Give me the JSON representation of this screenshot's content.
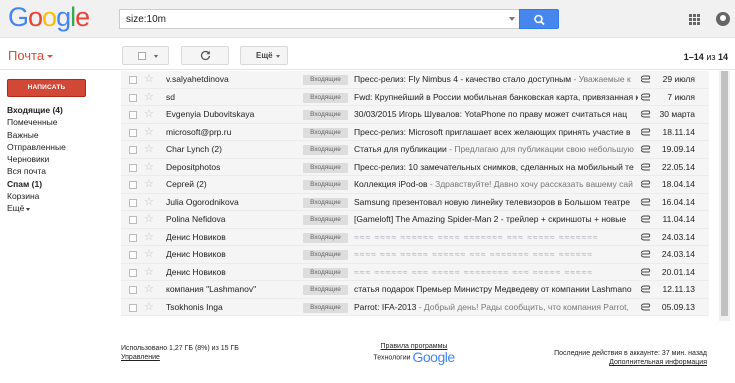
{
  "header": {
    "logo_letters": [
      "G",
      "o",
      "o",
      "g",
      "l",
      "e"
    ],
    "logo_colors": [
      "#4285f4",
      "#ea4335",
      "#fbbc05",
      "#4285f4",
      "#34a853",
      "#ea4335"
    ],
    "search_value": "size:10m",
    "search_button_color": "#4787ed"
  },
  "toolbar": {
    "mail_label": "Почта",
    "more_label": "Ещё",
    "pager_range": "1–14",
    "pager_of": "из",
    "pager_total": "14"
  },
  "sidebar": {
    "compose_label": "НАПИСАТЬ",
    "items": [
      {
        "label": "Входящие (4)",
        "bold": true
      },
      {
        "label": "Помеченные",
        "bold": false
      },
      {
        "label": "Важные",
        "bold": false
      },
      {
        "label": "Отправленные",
        "bold": false
      },
      {
        "label": "Черновики",
        "bold": false
      },
      {
        "label": "Вся почта",
        "bold": false
      },
      {
        "label": "Спам (1)",
        "bold": true
      },
      {
        "label": "Корзина",
        "bold": false
      },
      {
        "label": "Ещё",
        "bold": false
      }
    ]
  },
  "mail": {
    "label_text": "Входящие",
    "rows": [
      {
        "sender": "v.salyahetdinova",
        "subject": "Пресс-релиз: Fly Nimbus 4 - качество стало доступным",
        "snippet": " - Уважаемые к",
        "date": "29 июля"
      },
      {
        "sender": "sd",
        "subject": "Fwd: Крупнейший в России мобильная банковская карта, привязанная к су",
        "snippet": "",
        "date": "7 июля"
      },
      {
        "sender": "Evgenyia Dubovitskaya",
        "subject": "30/03/2015 Игорь Шувалов: YotaPhone по праву может считаться нац",
        "snippet": "",
        "date": "30 марта"
      },
      {
        "sender": "microsoft@prp.ru",
        "subject": "Пресс-релиз: Microsoft приглашает всех желающих принять участие в",
        "snippet": "",
        "date": "18.11.14"
      },
      {
        "sender": "Char Lynch (2)",
        "subject": "Статья для публикации",
        "snippet": " - Предлагаю для публикации свою небольшую",
        "date": "19.09.14"
      },
      {
        "sender": "Depositphotos",
        "subject": "Пресс-релиз: 10 замечательных снимков, сделанных на мобильный те",
        "snippet": "",
        "date": "22.05.14"
      },
      {
        "sender": "Сергей (2)",
        "subject": "Коллекция iPod-ов",
        "snippet": " - Здравствуйте! Давно хочу рассказать вашему сай",
        "date": "18.04.14"
      },
      {
        "sender": "Julia Ogorodnikova",
        "subject": "Samsung презентовал новую линейку телевизоров в Большом театре",
        "snippet": "",
        "date": "16.04.14"
      },
      {
        "sender": "Polina Nefidova",
        "subject": "[Gameloft] The Amazing Spider-Man 2 - трейлер + скриншоты + новые",
        "snippet": "",
        "date": "11.04.14"
      },
      {
        "sender": "Денис Новиков",
        "subject": "",
        "snippet": "",
        "obfuscated": "≈≈≈ ≈≈≈≈ ≈≈≈≈≈≈ ≈≈≈≈ ≈≈≈≈≈≈≈ ≈≈≈ ≈≈≈≈≈ ≈≈≈≈≈≈≈",
        "date": "24.03.14"
      },
      {
        "sender": "Денис Новиков",
        "subject": "",
        "snippet": "",
        "obfuscated": "≈≈≈≈ ≈≈≈ ≈≈≈≈≈ ≈≈≈≈≈≈ ≈≈≈ ≈≈≈≈≈≈≈ ≈≈≈≈ ≈≈≈≈≈≈",
        "date": "24.03.14"
      },
      {
        "sender": "Денис Новиков",
        "subject": "",
        "snippet": "",
        "obfuscated": "≈≈≈ ≈≈≈≈≈≈ ≈≈≈ ≈≈≈≈≈ ≈≈≈≈≈≈≈≈ ≈≈≈ ≈≈≈≈≈ ≈≈≈≈≈",
        "date": "20.01.14"
      },
      {
        "sender": "компания \"Lashmanov\"",
        "subject": "статья подарок Премьер Министру Медведеву от компании Lashmano",
        "snippet": "",
        "date": "12.11.13"
      },
      {
        "sender": "Tsokhonis Inga",
        "subject": "Parrot: IFA-2013",
        "snippet": " - Добрый день! Рады сообщить, что компания Parrot,",
        "date": "05.09.13"
      }
    ]
  },
  "footer": {
    "storage_text": "Использовано 1,27 ГБ (8%) из 15 ГБ",
    "manage_link": "Управление",
    "policy_link": "Правила программы",
    "tech_label": "Технологии",
    "tech_brand": "Google",
    "activity_text": "Последние действия в аккаунте: 37 мин. назад",
    "details_link": "Дополнительная информация"
  }
}
